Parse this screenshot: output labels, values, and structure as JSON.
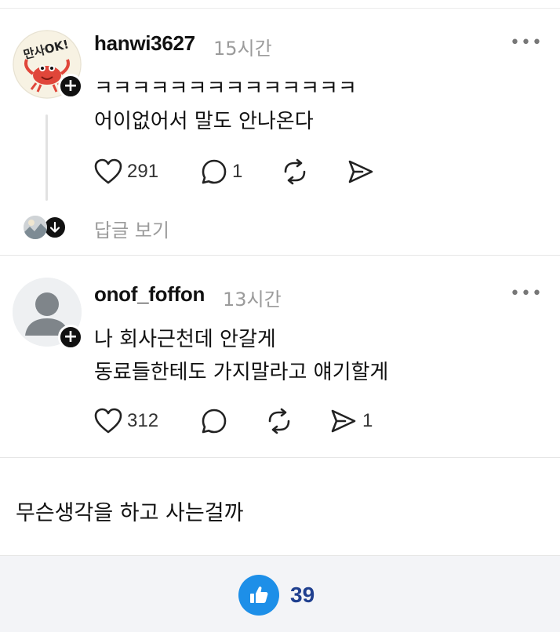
{
  "posts": [
    {
      "username": "hanwi3627",
      "time": "15시간",
      "more": "•••",
      "lines": [
        "ㅋㅋㅋㅋㅋㅋㅋㅋㅋㅋㅋㅋㅋㅋ",
        "어이없어서 말도 안나온다"
      ],
      "likes": "291",
      "comments": "1",
      "reposts": "",
      "shares": "",
      "avatar_icon": "crab-sticker-avatar",
      "avatar_text": "만사OK!",
      "reply_label": "답글 보기"
    },
    {
      "username": "onof_foffon",
      "time": "13시간",
      "more": "•••",
      "lines": [
        "나 회사근천데 안갈게",
        "동료들한테도 가지말라고 얘기할게"
      ],
      "likes": "312",
      "comments": "",
      "reposts": "",
      "shares": "1",
      "avatar_icon": "default-person-avatar"
    }
  ],
  "comment": "무슨생각을 하고 사는걸까",
  "footer": {
    "like_count": "39",
    "like_color": "#1d8fe8"
  },
  "icons": {
    "heart": "heart-icon",
    "comment": "comment-bubble-icon",
    "repost": "repost-icon",
    "share": "send-icon",
    "plus": "plus-icon",
    "arrow_down": "arrow-down-icon",
    "thumb": "thumbs-up-icon"
  }
}
